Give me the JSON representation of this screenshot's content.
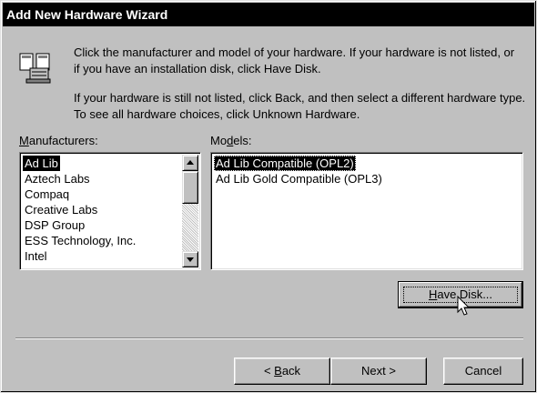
{
  "window": {
    "title": "Add New Hardware Wizard"
  },
  "intro": {
    "line1": "Click the manufacturer and model of your hardware. If your hardware is not listed, or if you have an installation disk, click Have Disk.",
    "line2": "If your hardware is still not listed, click Back, and then select a different hardware type. To see all hardware choices, click Unknown Hardware."
  },
  "manufacturers": {
    "label_prefix": "",
    "label_mnemonic": "M",
    "label_rest": "anufacturers:",
    "items": [
      "Ad Lib",
      "Aztech Labs",
      "Compaq",
      "Creative Labs",
      "DSP Group",
      "ESS Technology, Inc.",
      "Intel"
    ],
    "selected": "Ad Lib"
  },
  "models": {
    "label_prefix": "Mo",
    "label_mnemonic": "d",
    "label_rest": "els:",
    "items": [
      "Ad Lib Compatible (OPL2)",
      "Ad Lib Gold Compatible (OPL3)"
    ],
    "selected": "Ad Lib Compatible (OPL2)"
  },
  "buttons": {
    "have_disk_mnemonic": "H",
    "have_disk_rest": "ave Disk...",
    "back_prefix": "< ",
    "back_mnemonic": "B",
    "back_rest": "ack",
    "next": "Next >",
    "cancel": "Cancel"
  },
  "icons": {
    "wizard": "hardware-wizard-icon",
    "cursor": "arrow-cursor-icon"
  }
}
